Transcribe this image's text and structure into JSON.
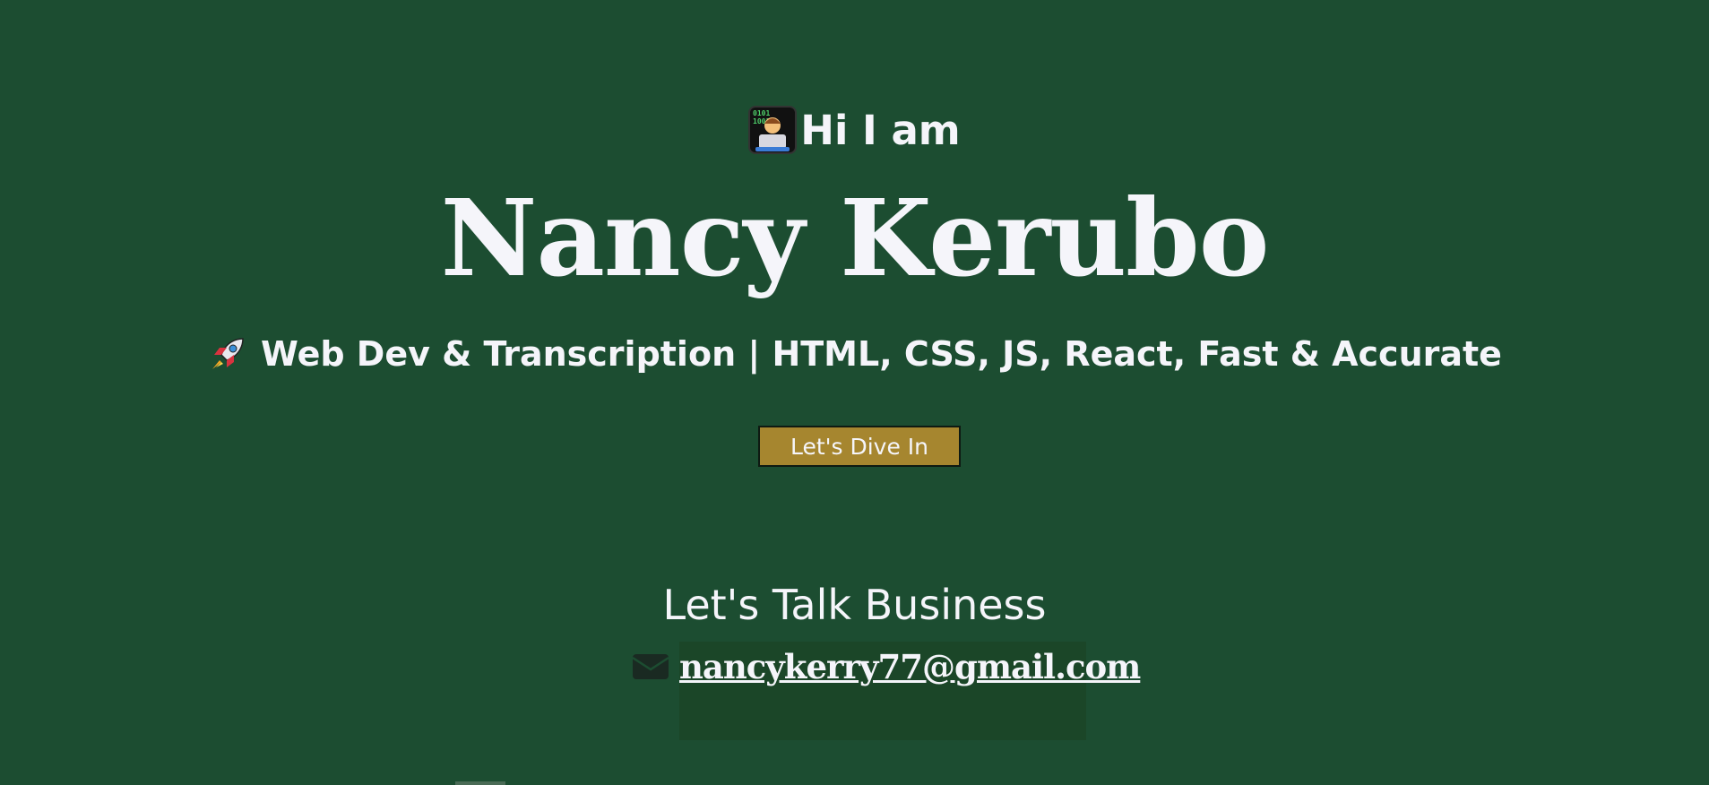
{
  "hero": {
    "greeting_icon": "technologist-icon",
    "greeting": "Hi I am",
    "name": "Nancy Kerubo",
    "tagline_icon": "rocket-icon",
    "tagline": "Web Dev & Transcription | HTML, CSS, JS, React, Fast & Accurate",
    "cta_label": "Let's Dive In"
  },
  "contact": {
    "heading": "Let's Talk Business",
    "email_icon": "envelope-icon",
    "email": "nancykerry77@gmail.com"
  },
  "colors": {
    "background": "#1c4d31",
    "text": "#f5f5fa",
    "button": "#a6862f",
    "email_box": "#1b4628"
  }
}
